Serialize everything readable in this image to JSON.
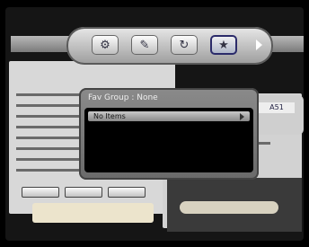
{
  "toolbar": {
    "tools": [
      {
        "icon": "tools-icon"
      },
      {
        "icon": "edit-list-icon"
      },
      {
        "icon": "move-icon"
      },
      {
        "icon": "fav-group-icon",
        "active": true
      }
    ],
    "next_arrow": "chevron-right-icon"
  },
  "dialog": {
    "title": "Fav Group : None",
    "items": [
      {
        "label": "No Items"
      }
    ]
  },
  "mini_panel": {
    "tag": "A51"
  }
}
